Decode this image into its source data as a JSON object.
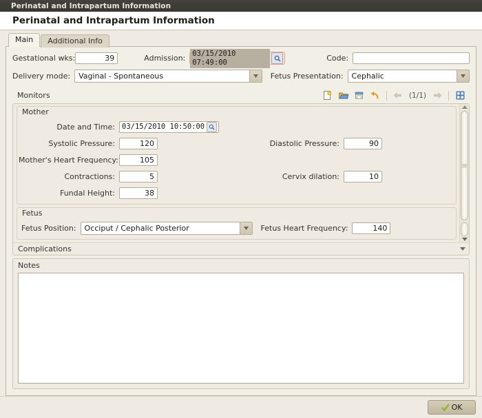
{
  "window": {
    "titlebar": "Perinatal and Intrapartum Information",
    "header_title": "Perinatal and Intrapartum Information"
  },
  "tabs": [
    {
      "label": "Main",
      "active": true
    },
    {
      "label": "Additional Info",
      "active": false
    }
  ],
  "form": {
    "gestational_weeks": {
      "label": "Gestational wks:",
      "value": "39"
    },
    "admission": {
      "label": "Admission:",
      "value": "03/15/2010 07:49:00",
      "icon": "calendar-picker-icon"
    },
    "code": {
      "label": "Code:",
      "value": "",
      "placeholder": ""
    },
    "delivery_mode": {
      "label": "Delivery mode:",
      "value": "Vaginal - Spontaneous"
    },
    "fetus_presentation": {
      "label": "Fetus Presentation:",
      "value": "Cephalic"
    }
  },
  "monitors": {
    "title": "Monitors",
    "toolbar": {
      "new_label": "new-document",
      "open_label": "open-folder",
      "save_label": "save",
      "undo_label": "undo",
      "prev_label": "previous",
      "next_label": "next",
      "pager": "(1/1)",
      "fullscreen_label": "fullscreen"
    },
    "mother": {
      "title": "Mother",
      "date_and_time": {
        "label": "Date and Time:",
        "value": "03/15/2010 10:50:00",
        "icon": "calendar-picker-icon"
      },
      "systolic_pressure": {
        "label": "Systolic Pressure:",
        "value": "120"
      },
      "diastolic_pressure": {
        "label": "Diastolic Pressure:",
        "value": "90"
      },
      "heart_frequency": {
        "label": "Mother's Heart Frequency:",
        "value": "105"
      },
      "contractions": {
        "label": "Contractions:",
        "value": "5"
      },
      "cervix_dilation": {
        "label": "Cervix dilation:",
        "value": "10"
      },
      "fundal_height": {
        "label": "Fundal Height:",
        "value": "38"
      }
    },
    "fetus": {
      "title": "Fetus",
      "position": {
        "label": "Fetus Position:",
        "value": "Occiput / Cephalic Posterior"
      },
      "heart_frequency": {
        "label": "Fetus Heart Frequency:",
        "value": "140"
      }
    },
    "complications": {
      "title": "Complications"
    }
  },
  "notes": {
    "label": "Notes",
    "value": "",
    "placeholder": ""
  },
  "footer": {
    "ok_label": "OK"
  },
  "colors": {
    "titlebar_bg": "#3a3833",
    "window_bg": "#efebe2",
    "panel_bg": "#f2efe7",
    "border": "#bdb6a6",
    "input_bg": "#ffffff",
    "focus_border": "#e7a7a3",
    "selection_bg": "#b7b0a0",
    "ok_check": "#8ab832"
  }
}
